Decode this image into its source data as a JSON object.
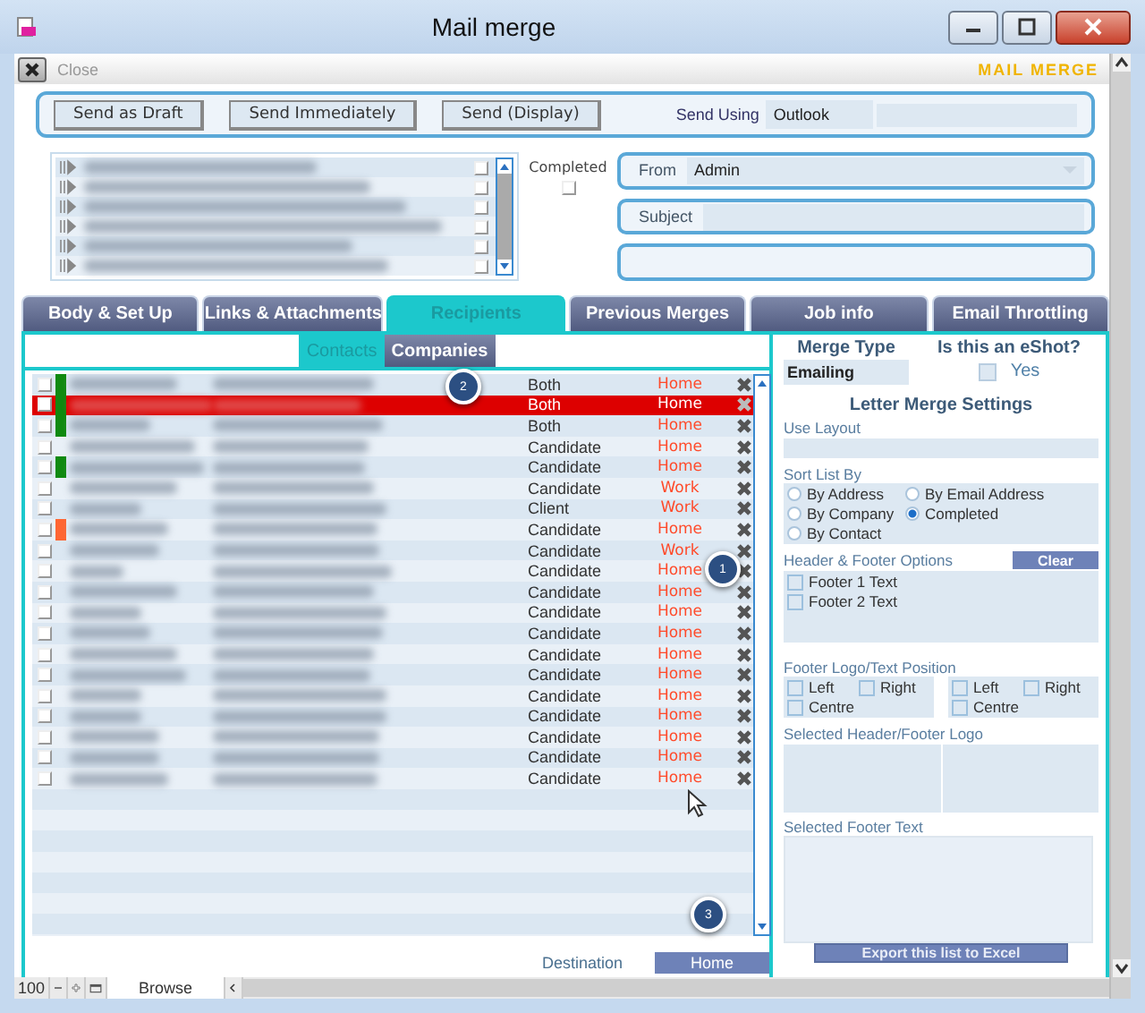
{
  "window": {
    "title": "Mail merge"
  },
  "toolbar": {
    "close_label": "Close",
    "brand": "MAIL MERGE"
  },
  "send_buttons": [
    "Send as Draft",
    "Send Immediately",
    "Send (Display)"
  ],
  "send_using": {
    "label": "Send Using",
    "value": "Outlook"
  },
  "attachments": [
    {
      "checked": false
    },
    {
      "checked": false
    },
    {
      "checked": false
    },
    {
      "checked": false
    },
    {
      "checked": false
    },
    {
      "checked": false
    }
  ],
  "completed": {
    "label": "Completed",
    "checked": false
  },
  "from": {
    "label": "From",
    "value": "Admin"
  },
  "subject": {
    "label": "Subject"
  },
  "tabs": [
    {
      "label": "Body & Set Up",
      "selected": false
    },
    {
      "label": "Links & Attachments",
      "selected": false
    },
    {
      "label": "Recipients",
      "selected": true
    },
    {
      "label": "Previous Merges",
      "selected": false
    },
    {
      "label": "Job info",
      "selected": false
    },
    {
      "label": "Email Throttling",
      "selected": false
    }
  ],
  "subtabs": [
    {
      "label": "Contacts",
      "selected": true
    },
    {
      "label": "Companies",
      "selected": false
    }
  ],
  "recipients": [
    {
      "type": "Both",
      "address": "Home",
      "checked": false,
      "selected": false,
      "color": "#108a10"
    },
    {
      "type": "Both",
      "address": "Home",
      "checked": false,
      "selected": true,
      "color": "#108a10"
    },
    {
      "type": "Both",
      "address": "Home",
      "checked": false,
      "selected": false,
      "color": "#108a10"
    },
    {
      "type": "Candidate",
      "address": "Home",
      "checked": false,
      "selected": false
    },
    {
      "type": "Candidate",
      "address": "Home",
      "checked": false,
      "selected": false,
      "color": "#108a10"
    },
    {
      "type": "Candidate",
      "address": "Work",
      "checked": false,
      "selected": false
    },
    {
      "type": "Client",
      "address": "Work",
      "checked": false,
      "selected": false
    },
    {
      "type": "Candidate",
      "address": "Home",
      "checked": false,
      "selected": false,
      "color": "#ff6633"
    },
    {
      "type": "Candidate",
      "address": "Work",
      "checked": false,
      "selected": false
    },
    {
      "type": "Candidate",
      "address": "Home",
      "checked": false,
      "selected": false
    },
    {
      "type": "Candidate",
      "address": "Home",
      "checked": false,
      "selected": false
    },
    {
      "type": "Candidate",
      "address": "Home",
      "checked": false,
      "selected": false
    },
    {
      "type": "Candidate",
      "address": "Home",
      "checked": false,
      "selected": false
    },
    {
      "type": "Candidate",
      "address": "Home",
      "checked": false,
      "selected": false
    },
    {
      "type": "Candidate",
      "address": "Home",
      "checked": false,
      "selected": false
    },
    {
      "type": "Candidate",
      "address": "Home",
      "checked": false,
      "selected": false
    },
    {
      "type": "Candidate",
      "address": "Home",
      "checked": false,
      "selected": false
    },
    {
      "type": "Candidate",
      "address": "Home",
      "checked": false,
      "selected": false
    },
    {
      "type": "Candidate",
      "address": "Home",
      "checked": false,
      "selected": false
    },
    {
      "type": "Candidate",
      "address": "Home",
      "checked": false,
      "selected": false
    }
  ],
  "destination": {
    "label": "Destination",
    "value": "Home"
  },
  "callouts": [
    "1",
    "2",
    "3"
  ],
  "merge_type": {
    "label": "Merge Type",
    "value": "Emailing"
  },
  "eshot": {
    "label": "Is this an eShot?",
    "option": "Yes",
    "checked": false
  },
  "letter_settings": {
    "title": "Letter Merge Settings",
    "use_layout_label": "Use Layout",
    "sort_label": "Sort List By",
    "sort_options": [
      {
        "label": "By Address",
        "selected": false
      },
      {
        "label": "By Email Address",
        "selected": false
      },
      {
        "label": "By Company",
        "selected": false
      },
      {
        "label": "Completed",
        "selected": true
      },
      {
        "label": "By Contact",
        "selected": false
      }
    ],
    "header_footer_label": "Header & Footer Options",
    "clear_button": "Clear",
    "footer_options": [
      {
        "label": "Footer 1 Text",
        "checked": false
      },
      {
        "label": "Footer 2 Text",
        "checked": false
      }
    ],
    "position_label": "Footer Logo/Text Position",
    "positions": [
      [
        {
          "label": "Left",
          "checked": false
        },
        {
          "label": "Right",
          "checked": false
        },
        {
          "label": "Centre",
          "checked": false
        }
      ],
      [
        {
          "label": "Left",
          "checked": false
        },
        {
          "label": "Right",
          "checked": false
        },
        {
          "label": "Centre",
          "checked": false
        }
      ]
    ],
    "logo_label": "Selected Header/Footer Logo",
    "footer_text_label": "Selected Footer Text"
  },
  "export_button": "Export this list to Excel",
  "status_bar": {
    "zoom": "100",
    "mode": "Browse"
  }
}
